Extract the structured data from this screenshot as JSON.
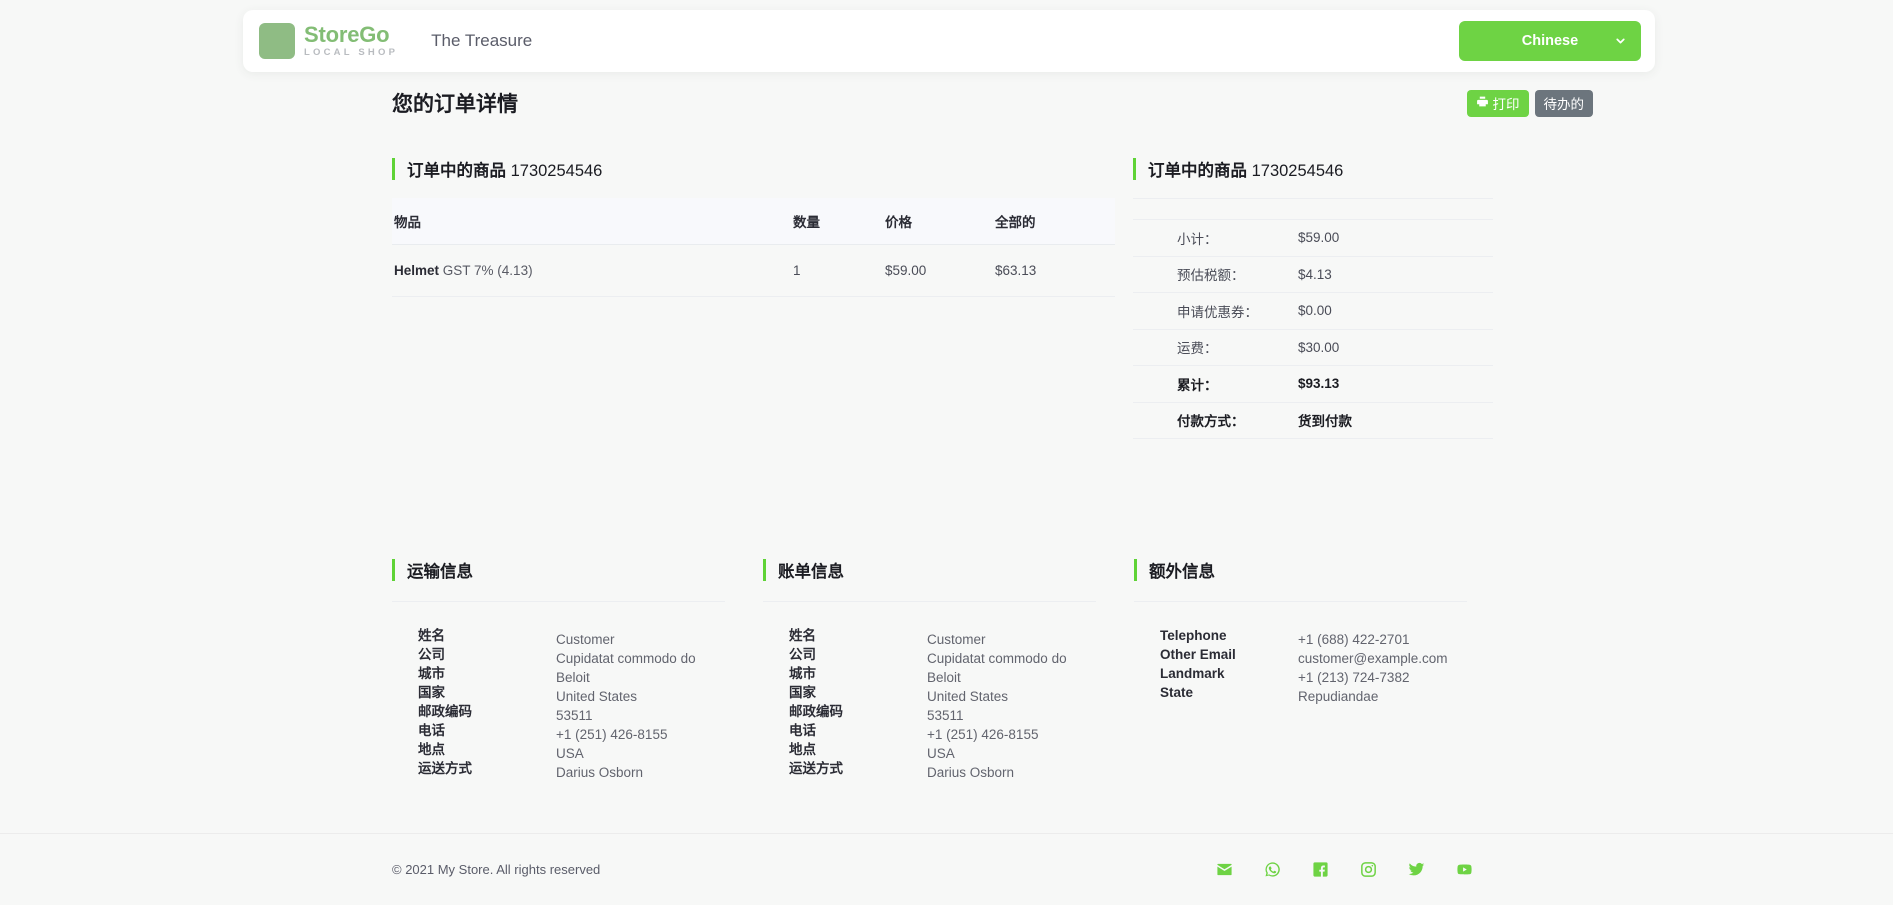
{
  "header": {
    "logo_name": "StoreGo",
    "logo_sub": "LOCAL SHOP",
    "store_title": "The Treasure",
    "language": "Chinese"
  },
  "page": {
    "title": "您的订单详情",
    "print_label": "打印",
    "status_label": "待办的"
  },
  "items_card": {
    "heading": "订单中的商品",
    "order_number": "1730254546",
    "columns": {
      "item": "物品",
      "qty": "数量",
      "price": "价格",
      "total": "全部的"
    },
    "rows": [
      {
        "name": "Helmet",
        "tax": "GST 7% (4.13)",
        "qty": "1",
        "price": "$59.00",
        "total": "$63.13"
      }
    ]
  },
  "summary_card": {
    "heading": "订单中的商品",
    "order_number": "1730254546",
    "rows": [
      {
        "label": "小计：",
        "value": "$59.00"
      },
      {
        "label": "预估税额：",
        "value": "$4.13"
      },
      {
        "label": "申请优惠券：",
        "value": "$0.00"
      },
      {
        "label": "运费：",
        "value": "$30.00"
      },
      {
        "label": "累计：",
        "value": "$93.13"
      },
      {
        "label": "付款方式：",
        "value": "货到付款"
      }
    ]
  },
  "shipping": {
    "heading": "运输信息",
    "labels": [
      "姓名",
      "公司",
      "城市",
      "国家",
      "邮政编码",
      "电话",
      "地点",
      "运送方式"
    ],
    "values": [
      "Customer",
      "Cupidatat commodo do",
      "Beloit",
      "United States",
      "53511",
      "+1 (251) 426-8155",
      "USA",
      "Darius Osborn"
    ]
  },
  "billing": {
    "heading": "账单信息",
    "labels": [
      "姓名",
      "公司",
      "城市",
      "国家",
      "邮政编码",
      "电话",
      "地点",
      "运送方式"
    ],
    "values": [
      "Customer",
      "Cupidatat commodo do",
      "Beloit",
      "United States",
      "53511",
      "+1 (251) 426-8155",
      "USA",
      "Darius Osborn"
    ]
  },
  "extra": {
    "heading": "额外信息",
    "labels": [
      "Telephone",
      "Other Email",
      "Landmark",
      "State"
    ],
    "values": [
      "+1 (688) 422-2701",
      "customer@example.com",
      "+1 (213) 724-7382",
      "Repudiandae"
    ]
  },
  "footer": {
    "copyright": "© 2021 My Store. All rights reserved",
    "socials": [
      "email-icon",
      "whatsapp-icon",
      "facebook-icon",
      "instagram-icon",
      "twitter-icon",
      "youtube-icon"
    ]
  },
  "colors": {
    "accent_green": "#6ed344",
    "logo_green": "#8fbc84",
    "status_gray": "#6c757d",
    "page_bg": "#f7f8f7"
  }
}
